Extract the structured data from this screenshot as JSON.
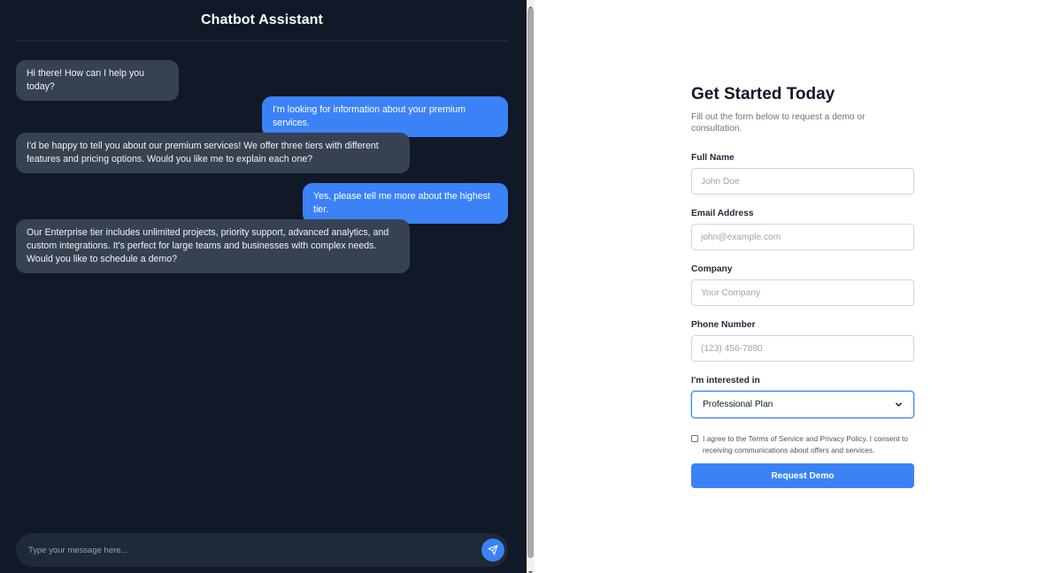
{
  "chat": {
    "title": "Chatbot Assistant",
    "messages": [
      {
        "from": "bot",
        "text": "Hi there! How can I help you today?"
      },
      {
        "from": "user",
        "text": "I'm looking for information about your premium services."
      },
      {
        "from": "bot",
        "text": "I'd be happy to tell you about our premium services! We offer three tiers with different features and pricing options. Would you like me to explain each one?"
      },
      {
        "from": "user",
        "text": "Yes, please tell me more about the highest tier."
      },
      {
        "from": "bot",
        "text": "Our Enterprise tier includes unlimited projects, priority support, advanced analytics, and custom integrations. It's perfect for large teams and businesses with complex needs. Would you like to schedule a demo?"
      }
    ],
    "input_placeholder": "Type your message here...",
    "send_icon": "send-icon"
  },
  "form": {
    "title": "Get Started Today",
    "subtitle": "Fill out the form below to request a demo or consultation.",
    "fields": [
      {
        "label": "Full Name",
        "placeholder": "John Doe"
      },
      {
        "label": "Email Address",
        "placeholder": "john@example.com"
      },
      {
        "label": "Company",
        "placeholder": "Your Company"
      },
      {
        "label": "Phone Number",
        "placeholder": "(123) 456-7890"
      }
    ],
    "interest": {
      "label": "I'm interested in",
      "selected": "Professional Plan"
    },
    "agree_text": "I agree to the Terms of Service and Privacy Policy. I consent to receiving communications about offers and services.",
    "submit_label": "Request Demo"
  },
  "colors": {
    "chat_bg": "#111827",
    "bot_bubble": "#374151",
    "user_bubble": "#3b82f6",
    "accent": "#3b82f6"
  }
}
